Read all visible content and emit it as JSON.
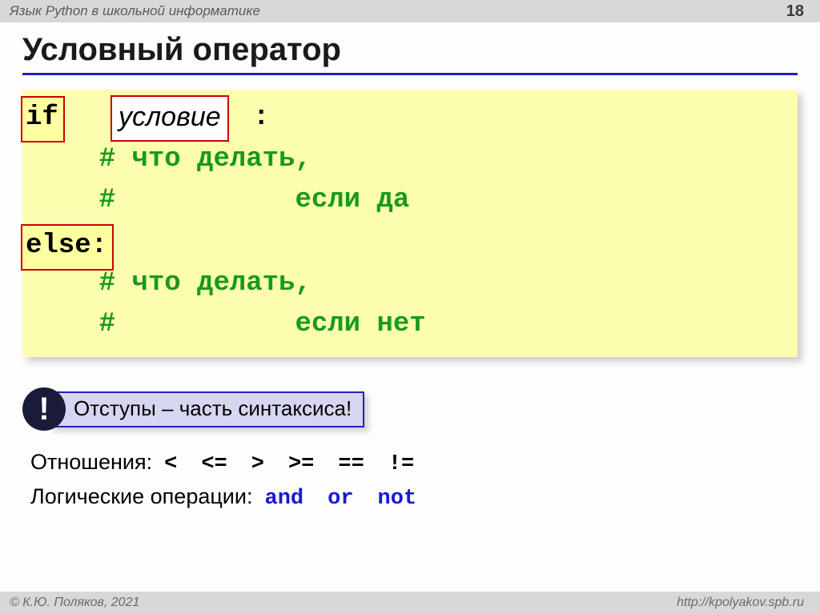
{
  "header": {
    "title": "Язык Python в школьной  информатике",
    "page": "18"
  },
  "heading": "Условный оператор",
  "code": {
    "if_kw": "if",
    "condition": "условие",
    "colon": ":",
    "comment1a": "# что делать,",
    "comment1b": "#           если да",
    "else_kw": "else:",
    "comment2a": "# что делать,",
    "comment2b": "#           если нет"
  },
  "callout": {
    "bang": "!",
    "text": "Отступы – часть синтаксиса!"
  },
  "relations": {
    "label": "Отношения:",
    "ops": [
      "<",
      "<=",
      ">",
      ">=",
      "==",
      "!="
    ]
  },
  "logic": {
    "label": "Логические операции:",
    "ops": [
      "and",
      "or",
      "not"
    ]
  },
  "footer": {
    "copyright": "© К.Ю. Поляков, 2021",
    "url": "http://kpolyakov.spb.ru"
  }
}
